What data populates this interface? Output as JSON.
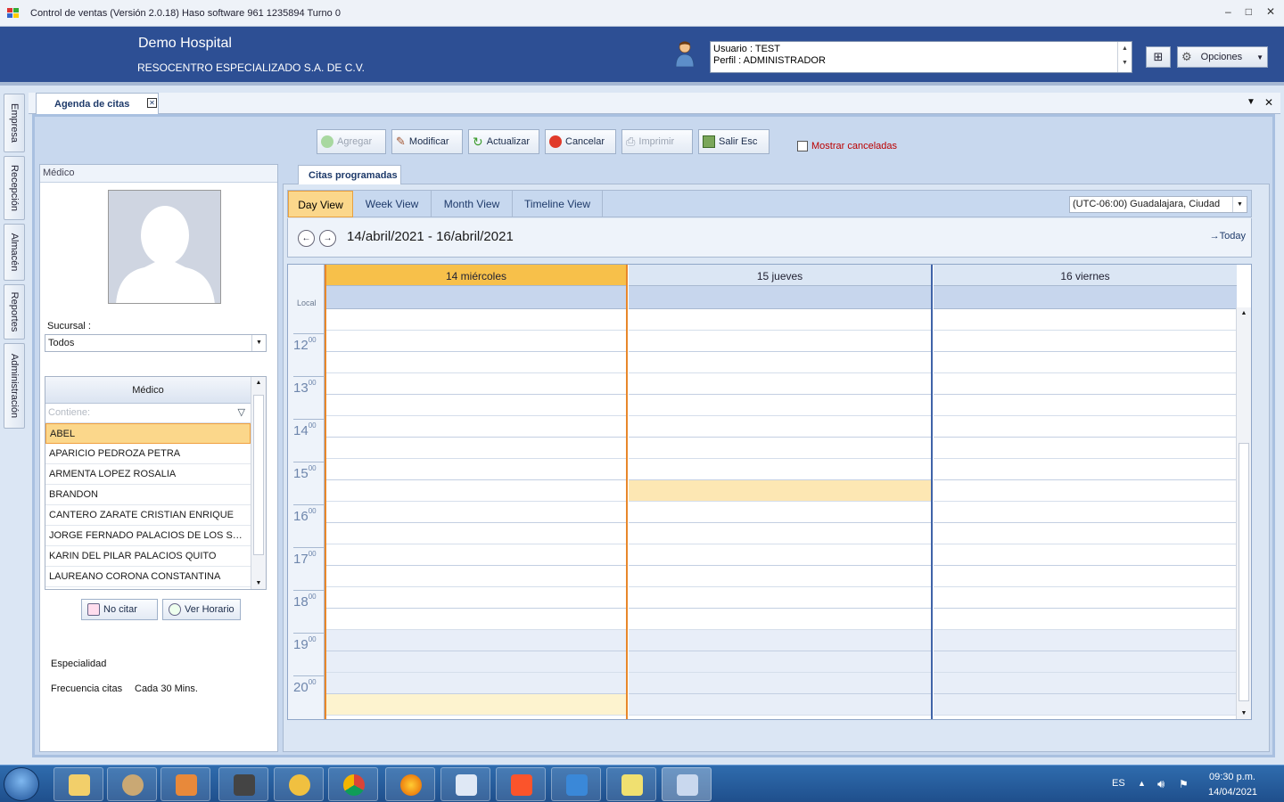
{
  "window": {
    "title": "Control de ventas  (Versión 2.0.18)  Haso software  961 1235894  Turno 0"
  },
  "header": {
    "company": "Demo Hospital",
    "subcompany": "RESOCENTRO ESPECIALIZADO S.A. DE C.V.",
    "user_line": "Usuario : TEST",
    "profile_line": "Perfil : ADMINISTRADOR",
    "options_label": "Opciones"
  },
  "vtabs": [
    "Empresa",
    "Recepción",
    "Almacén",
    "Reportes",
    "Administración"
  ],
  "doc_tab": {
    "label": "Agenda de citas"
  },
  "toolbar": {
    "agregar": "Agregar",
    "modificar": "Modificar",
    "actualizar": "Actualizar",
    "cancelar": "Cancelar",
    "imprimir": "Imprimir",
    "salir": "Salir  Esc",
    "mostrar_canceladas": "Mostrar canceladas"
  },
  "medico_panel": {
    "header": "Médico",
    "sucursal_label": "Sucursal :",
    "sucursal_value": "Todos",
    "grid_header": "Médico",
    "filter_placeholder": "Contiene:",
    "doctors": [
      "ABEL",
      "APARICIO PEDROZA PETRA",
      "ARMENTA LOPEZ ROSALIA",
      "BRANDON",
      "CANTERO ZARATE CRISTIAN ENRIQUE",
      "JORGE FERNADO PALACIOS DE LOS SANT…",
      "KARIN DEL PILAR PALACIOS QUITO",
      "LAUREANO CORONA CONSTANTINA"
    ],
    "no_citar": "No citar",
    "ver_horario": "Ver  Horario",
    "especialidad_label": "Especialidad",
    "frecuencia_label": "Frecuencia citas",
    "frecuencia_value": "Cada 30 Mins."
  },
  "scheduler": {
    "tab": "Citas programadas",
    "views": [
      "Day View",
      "Week View",
      "Month View",
      "Timeline View"
    ],
    "active_view": "Day View",
    "timezone": "(UTC-06:00) Guadalajara, Ciudad",
    "date_range": "14/abril/2021 - 16/abril/2021",
    "today": "Today",
    "local_label": "Local",
    "days": [
      "14 miércoles",
      "15 jueves",
      "16 viernes"
    ],
    "hours": [
      "12",
      "13",
      "14",
      "15",
      "16",
      "17",
      "18",
      "19",
      "20"
    ],
    "minutes_suffix": "00"
  },
  "taskbar": {
    "lang": "ES",
    "time": "09:30 p.m.",
    "date": "14/04/2021"
  },
  "colors": {
    "header_blue": "#2d4f94",
    "selection_orange": "#fbd78b",
    "today_header": "#f7c04a",
    "taskbar": "#2f6cae"
  }
}
